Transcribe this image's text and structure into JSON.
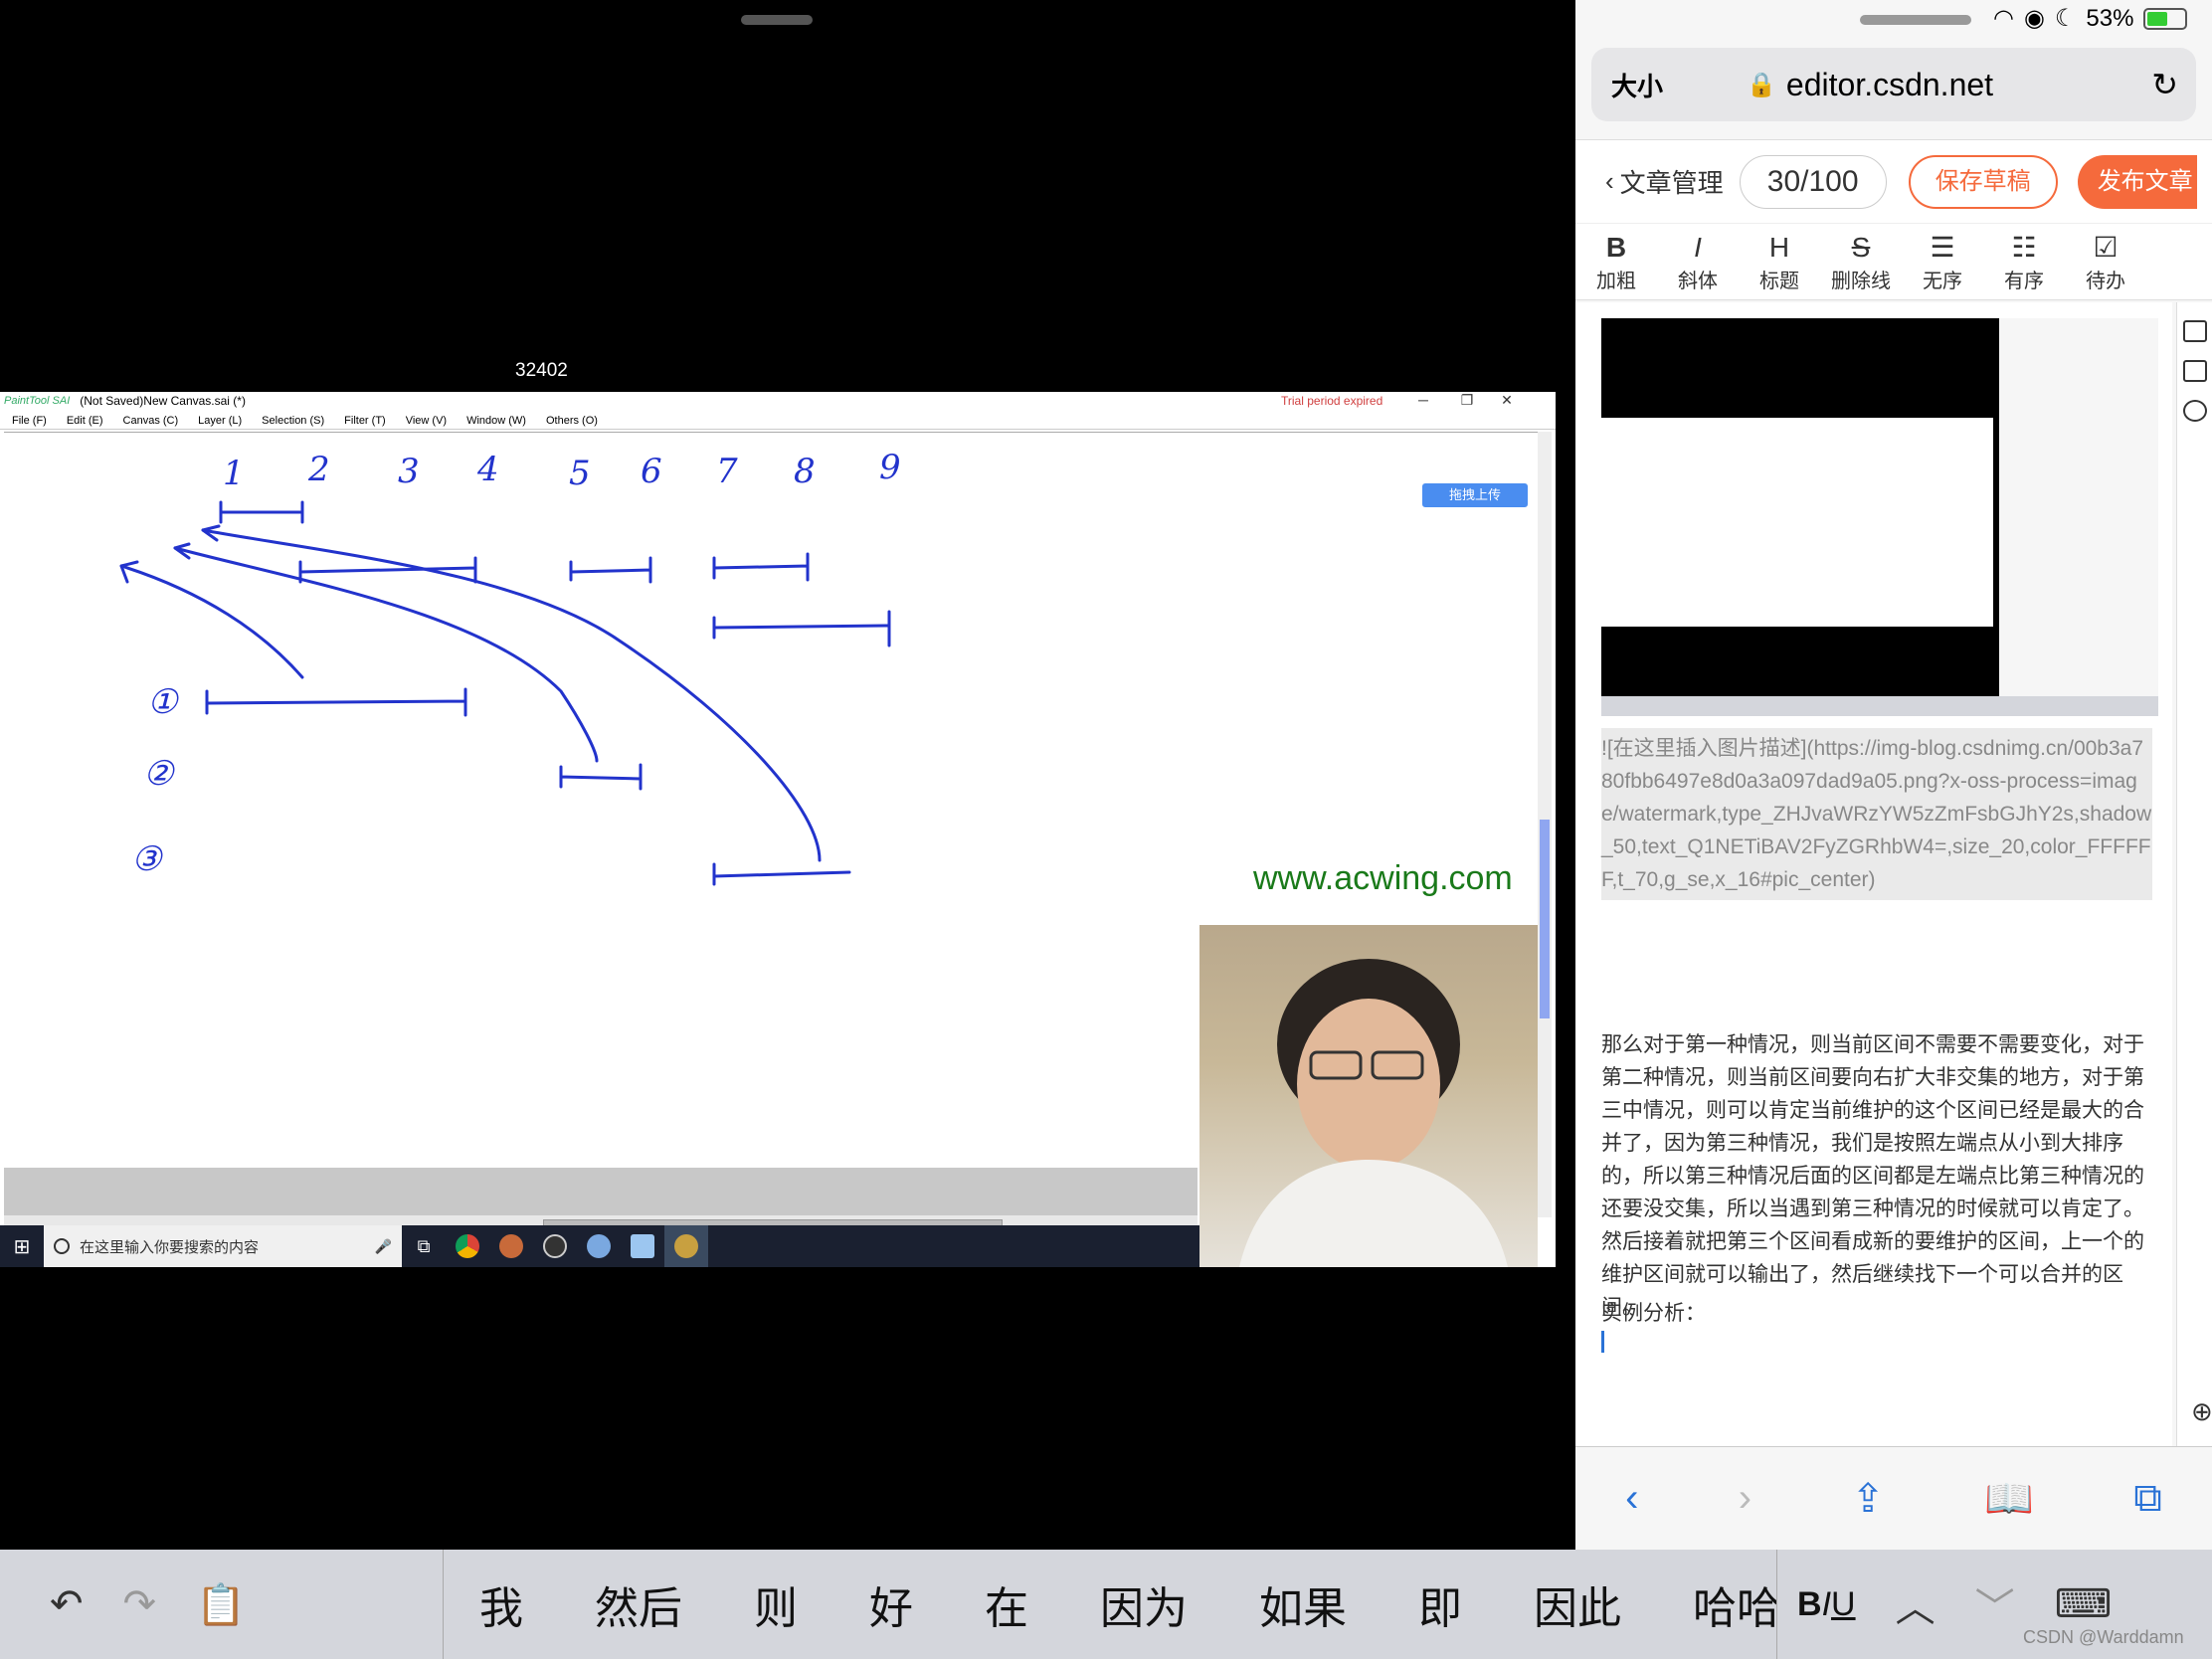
{
  "video": {
    "number": "32402",
    "sai": {
      "logo": "PaintTool SAI",
      "title": "(Not Saved)New Canvas.sai (*)",
      "trial": "Trial period expired",
      "controls": [
        "─",
        "❐",
        "✕"
      ],
      "menus": [
        "File (F)",
        "Edit (E)",
        "Canvas (C)",
        "Layer (L)",
        "Selection (S)",
        "Filter (T)",
        "View (V)",
        "Window (W)",
        "Others (O)"
      ],
      "upload_label": "拖拽上传",
      "watermark": "www.acwing.com",
      "numbers": [
        "1",
        "2",
        "3",
        "4",
        "5",
        "6",
        "7",
        "8",
        "9"
      ],
      "circled": [
        "①",
        "②",
        "③"
      ]
    },
    "taskbar": {
      "search_placeholder": "在这里输入你要搜索的内容",
      "win_icon": "windows-icon"
    }
  },
  "safari": {
    "status": {
      "battery": "53%",
      "battery_level": 0.53
    },
    "url": {
      "size_label": "大小",
      "domain": "editor.csdn.net"
    },
    "toolbar": {
      "back_label": "文章管理",
      "counter": "30/100",
      "save_draft": "保存草稿",
      "publish": "发布文章"
    },
    "format": [
      {
        "glyph": "B",
        "label": "加粗"
      },
      {
        "glyph": "I",
        "label": "斜体"
      },
      {
        "glyph": "H",
        "label": "标题"
      },
      {
        "glyph": "S",
        "label": "删除线"
      },
      {
        "glyph": "☰",
        "label": "无序"
      },
      {
        "glyph": "☷",
        "label": "有序"
      },
      {
        "glyph": "☑",
        "label": "待办"
      }
    ],
    "editor": {
      "image_markdown": "![在这里插入图片描述](https://img-blog.csdnimg.cn/00b3a780fbb6497e8d0a3a097dad9a05.png?x-oss-process=image/watermark,type_ZHJvaWRzYW5zZmFsbGJhY2s,shadow_50,text_Q1NETiBAV2FyZGRhbW4=,size_20,color_FFFFFF,t_70,g_se,x_16#pic_center)",
      "body": "那么对于第一种情况，则当前区间不需要不需要变化，对于第二种情况，则当前区间要向右扩大非交集的地方，对于第三中情况，则可以肯定当前维护的这个区间已经是最大的合并了，因为第三种情况，我们是按照左端点从小到大排序的，所以第三种情况后面的区间都是左端点比第三种情况的还要没交集，所以当遇到第三种情况的时候就可以肯定了。然后接着就把第三个区间看成新的要维护的区间，上一个的维护区间就可以输出了，然后继续找下一个可以合并的区间。",
      "case_label": "实例分析："
    }
  },
  "keyboard": {
    "candidates": [
      "我",
      "然后",
      "则",
      "好",
      "在",
      "因为",
      "如果",
      "即",
      "因此",
      "哈哈"
    ],
    "biu": {
      "b": "B",
      "i": "I",
      "u": "U"
    }
  },
  "watermark": "CSDN @Warddamn"
}
